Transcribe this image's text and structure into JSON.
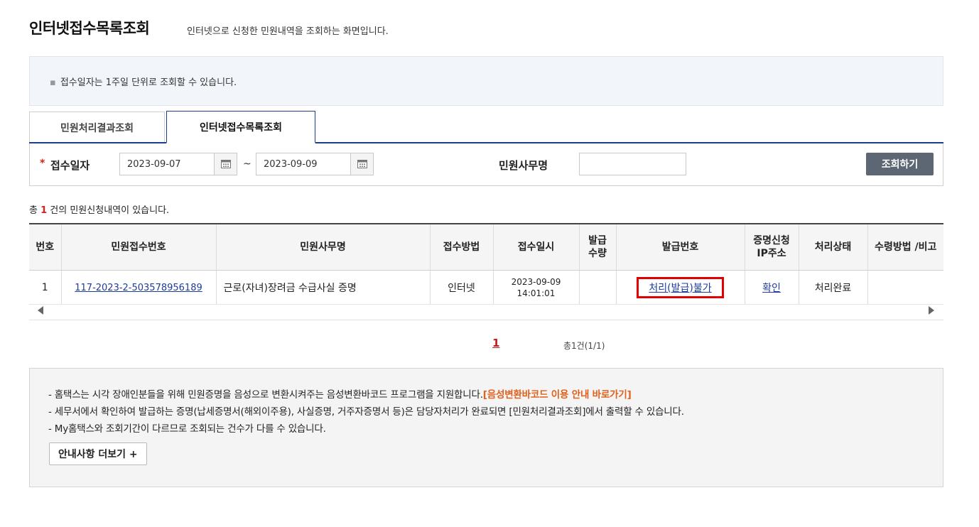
{
  "header": {
    "title": "인터넷접수목록조회",
    "subtitle": "인터넷으로 신청한 민원내역을 조회하는 화면입니다."
  },
  "notice": {
    "text": "접수일자는 1주일 단위로 조회할 수 있습니다."
  },
  "tabs": [
    {
      "label": "민원처리결과조회",
      "active": false
    },
    {
      "label": "인터넷접수목록조회",
      "active": true
    }
  ],
  "search": {
    "required_mark": "*",
    "date_label": "접수일자",
    "date_from": "2023-09-07",
    "date_sep": "~",
    "date_to": "2023-09-09",
    "office_label": "민원사무명",
    "office_value": "",
    "search_button": "조회하기"
  },
  "count": {
    "prefix": "총",
    "value": "1",
    "suffix": "건의 민원신청내역이 있습니다."
  },
  "table": {
    "headers": [
      "번호",
      "민원접수번호",
      "민원사무명",
      "접수방법",
      "접수일시",
      "발급 수량",
      "발급번호",
      "증명신청 IP주소",
      "처리상태",
      "수령방법 /비고"
    ],
    "rows": [
      {
        "no": "1",
        "receipt_no": "117-2023-2-503578956189",
        "office": "근로(자녀)장려금 수급사실 증명",
        "method": "인터넷",
        "date": "2023-09-09",
        "time": "14:01:01",
        "qty": "",
        "issue_no": "처리(발급)불가",
        "ip": "확인",
        "status": "처리완료",
        "note": ""
      }
    ]
  },
  "paging": {
    "current": "1",
    "total": "총1건(1/1)"
  },
  "info": {
    "line1": "- 홈택스는 시각 장애인분들을 위해 민원증명을 음성으로 변환시켜주는 음성변환바코드 프로그램을 지원합니다.",
    "line1_link": "[음성변환바코드 이용 안내 바로가기]",
    "line2": "- 세무서에서 확인하여 발급하는 증명(납세증명서(해외이주용), 사실증명, 거주자증명서 등)은 담당자처리가 완료되면 [민원처리결과조회]에서 출력할 수 있습니다.",
    "line3": "- My홈택스와 조회기간이 다르므로 조회되는 건수가 다를 수 있습니다.",
    "more_button": "안내사항 더보기 +"
  },
  "colors": {
    "accent": "#1b3e8a",
    "required": "#d9201b",
    "link": "#1d3c9b",
    "highlight_border": "#e00000",
    "info_link": "#e0601c",
    "button_bg": "#5d6673"
  }
}
